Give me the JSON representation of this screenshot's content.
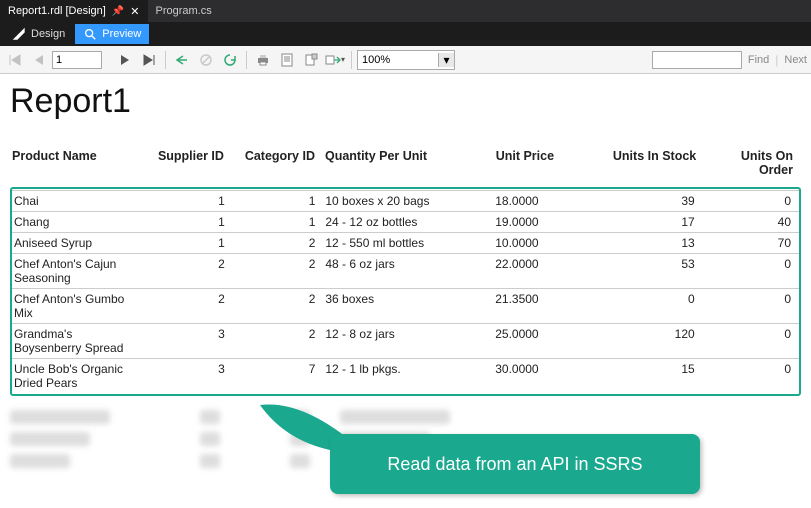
{
  "doc_tabs": {
    "active": {
      "label": "Report1.rdl [Design]"
    },
    "other": {
      "label": "Program.cs"
    }
  },
  "view_tabs": {
    "design": "Design",
    "preview": "Preview"
  },
  "toolbar": {
    "page_value": "1",
    "zoom_value": "100%",
    "find_label": "Find",
    "next_label": "Next"
  },
  "report": {
    "title": "Report1",
    "headers": {
      "product": "Product Name",
      "supplier": "Supplier ID",
      "category": "Category ID",
      "qty": "Quantity Per Unit",
      "price": "Unit Price",
      "stock": "Units In Stock",
      "order": "Units On Order"
    },
    "rows": [
      {
        "product": "Chai",
        "supplier": "1",
        "category": "1",
        "qty": "10 boxes x 20 bags",
        "price": "18.0000",
        "stock": "39",
        "order": "0"
      },
      {
        "product": "Chang",
        "supplier": "1",
        "category": "1",
        "qty": "24 - 12 oz bottles",
        "price": "19.0000",
        "stock": "17",
        "order": "40"
      },
      {
        "product": "Aniseed Syrup",
        "supplier": "1",
        "category": "2",
        "qty": "12 - 550 ml bottles",
        "price": "10.0000",
        "stock": "13",
        "order": "70"
      },
      {
        "product": "Chef Anton's Cajun Seasoning",
        "supplier": "2",
        "category": "2",
        "qty": "48 - 6 oz jars",
        "price": "22.0000",
        "stock": "53",
        "order": "0"
      },
      {
        "product": "Chef Anton's Gumbo Mix",
        "supplier": "2",
        "category": "2",
        "qty": "36 boxes",
        "price": "21.3500",
        "stock": "0",
        "order": "0"
      },
      {
        "product": "Grandma's Boysenberry Spread",
        "supplier": "3",
        "category": "2",
        "qty": "12 - 8 oz jars",
        "price": "25.0000",
        "stock": "120",
        "order": "0"
      },
      {
        "product": "Uncle Bob's Organic Dried Pears",
        "supplier": "3",
        "category": "7",
        "qty": "12 - 1 lb pkgs.",
        "price": "30.0000",
        "stock": "15",
        "order": "0"
      }
    ]
  },
  "callout": {
    "text": "Read data from an API in SSRS"
  }
}
